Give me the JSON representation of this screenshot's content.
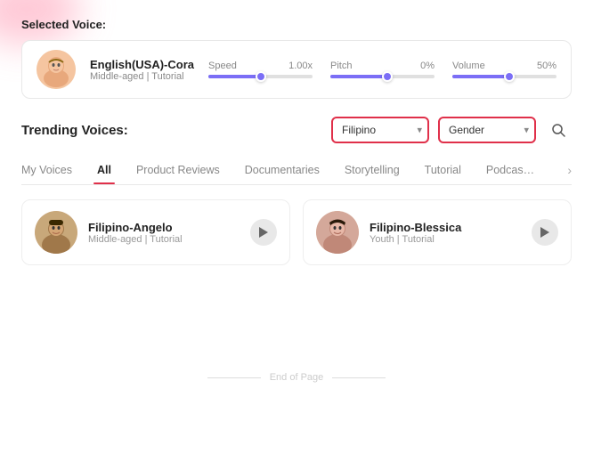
{
  "selectedVoice": {
    "label": "Selected Voice:",
    "avatar": "😊",
    "name": "English(USA)-Cora",
    "meta": "Middle-aged | Tutorial",
    "speed": {
      "label": "Speed",
      "value": "1.00x",
      "fillPercent": 50,
      "thumbPercent": 50
    },
    "pitch": {
      "label": "Pitch",
      "value": "0%",
      "fillPercent": 55,
      "thumbPercent": 55
    },
    "volume": {
      "label": "Volume",
      "value": "50%",
      "fillPercent": 55,
      "thumbPercent": 55
    }
  },
  "trending": {
    "label": "Trending Voices:",
    "filterLanguage": "Filipino",
    "filterGender": "Gender",
    "filterLanguagePlaceholder": "Filipino",
    "filterGenderPlaceholder": "Gender"
  },
  "tabs": [
    {
      "id": "my-voices",
      "label": "My Voices",
      "active": false
    },
    {
      "id": "all",
      "label": "All",
      "active": true
    },
    {
      "id": "product-reviews",
      "label": "Product Reviews",
      "active": false
    },
    {
      "id": "documentaries",
      "label": "Documentaries",
      "active": false
    },
    {
      "id": "storytelling",
      "label": "Storytelling",
      "active": false
    },
    {
      "id": "tutorial",
      "label": "Tutorial",
      "active": false
    },
    {
      "id": "podcast",
      "label": "Podcas…",
      "active": false
    }
  ],
  "voiceCards": [
    {
      "avatar": "👨",
      "name": "Filipino-Angelo",
      "meta": "Middle-aged | Tutorial"
    },
    {
      "avatar": "👩",
      "name": "Filipino-Blessica",
      "meta": "Youth | Tutorial"
    }
  ],
  "endOfPage": "End of Page"
}
